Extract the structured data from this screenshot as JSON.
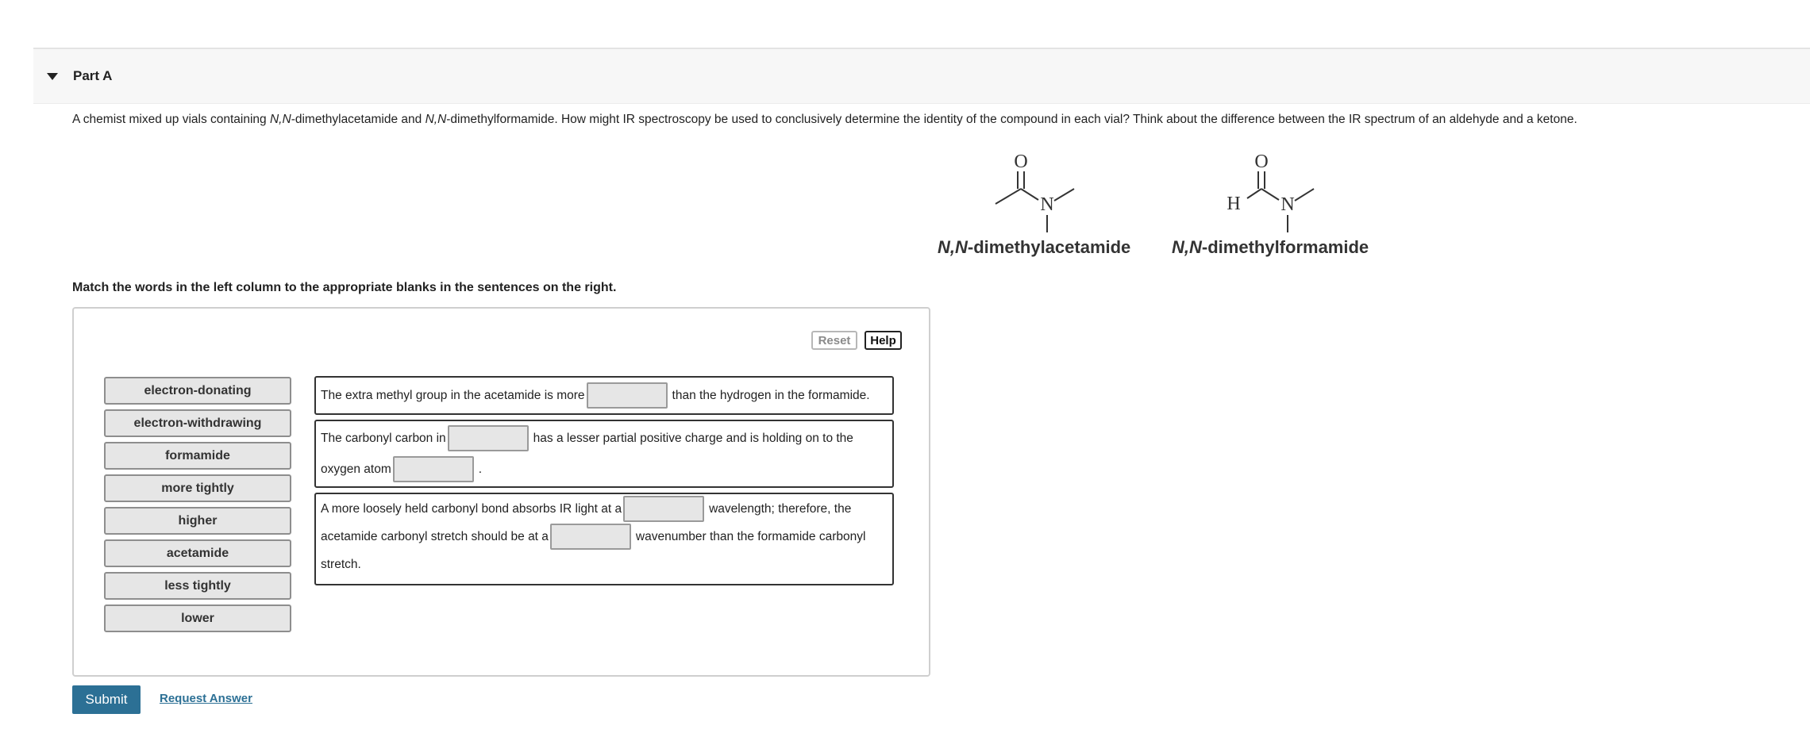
{
  "part": {
    "title": "Part A"
  },
  "question": {
    "pre1": "A chemist mixed up vials containing ",
    "ital1": "N,N",
    "mid1": "-dimethylacetamide and ",
    "ital2": "N,N",
    "post": "-dimethylformamide. How might IR spectroscopy be used to conclusively determine the identity of the compound in each vial? Think about the difference between the IR spectrum of an aldehyde and a ketone."
  },
  "structures": {
    "acetamide": {
      "ital": "N,N",
      "rest": "-dimethylacetamide",
      "atom_O": "O",
      "atom_N": "N"
    },
    "formamide": {
      "ital": "N,N",
      "rest": "-dimethylformamide",
      "atom_O": "O",
      "atom_N": "N",
      "atom_H": "H"
    }
  },
  "instruction": "Match the words in the left column to the appropriate blanks in the sentences on the right.",
  "controls": {
    "reset": "Reset",
    "help": "Help"
  },
  "word_bank": [
    "electron-donating",
    "electron-withdrawing",
    "formamide",
    "more tightly",
    "higher",
    "acetamide",
    "less tightly",
    "lower"
  ],
  "sentences": {
    "s1": {
      "a": "The extra methyl group in the acetamide is more",
      "b": "than the hydrogen in the formamide."
    },
    "s2": {
      "a": "The carbonyl carbon in",
      "b": "has a lesser partial positive charge and is holding on to the",
      "c": "oxygen atom",
      "d": "."
    },
    "s3": {
      "a": "A more loosely held carbonyl bond absorbs IR light at a",
      "b": "wavelength; therefore, the",
      "c": "acetamide carbonyl stretch should be at a",
      "d": "wavenumber than the formamide carbonyl",
      "e": "stretch."
    }
  },
  "actions": {
    "submit": "Submit",
    "request_answer": "Request Answer"
  },
  "colors": {
    "accent": "#2c7095",
    "tile_bg": "#e6e6e6"
  }
}
